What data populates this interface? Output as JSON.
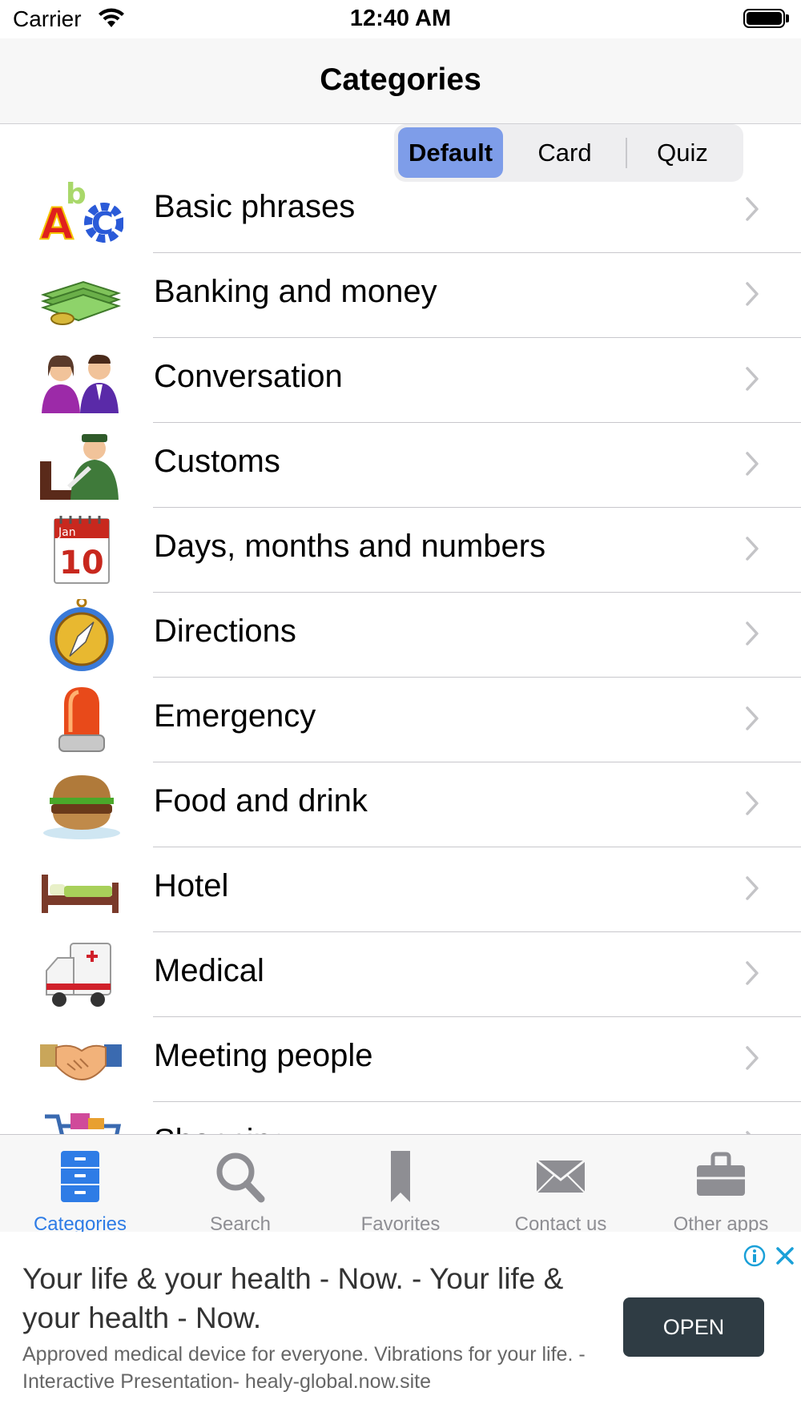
{
  "status_bar": {
    "carrier": "Carrier",
    "time": "12:40 AM"
  },
  "nav": {
    "title": "Categories"
  },
  "segments": [
    {
      "label": "Default",
      "selected": true
    },
    {
      "label": "Card",
      "selected": false
    },
    {
      "label": "Quiz",
      "selected": false
    }
  ],
  "list": {
    "items": [
      {
        "label": "Basic phrases",
        "icon": "abc-letters-icon"
      },
      {
        "label": "Banking and money",
        "icon": "money-stack-icon"
      },
      {
        "label": "Conversation",
        "icon": "people-talking-icon"
      },
      {
        "label": "Customs",
        "icon": "customs-officer-icon"
      },
      {
        "label": "Days, months and numbers",
        "icon": "calendar-icon"
      },
      {
        "label": "Directions",
        "icon": "compass-icon"
      },
      {
        "label": "Emergency",
        "icon": "siren-icon"
      },
      {
        "label": "Food and drink",
        "icon": "burger-icon"
      },
      {
        "label": "Hotel",
        "icon": "bed-icon"
      },
      {
        "label": "Medical",
        "icon": "ambulance-icon"
      },
      {
        "label": "Meeting people",
        "icon": "handshake-icon"
      },
      {
        "label": "Shopping",
        "icon": "shopping-cart-icon"
      }
    ],
    "calendar_icon_text": {
      "month": "Jan",
      "day": "10"
    }
  },
  "tabs": [
    {
      "label": "Categories",
      "icon": "file-cabinet-icon",
      "active": true
    },
    {
      "label": "Search",
      "icon": "magnifier-icon",
      "active": false
    },
    {
      "label": "Favorites",
      "icon": "bookmark-icon",
      "active": false
    },
    {
      "label": "Contact us",
      "icon": "envelope-icon",
      "active": false
    },
    {
      "label": "Other apps",
      "icon": "briefcase-icon",
      "active": false
    }
  ],
  "ad": {
    "title": "Your life & your health - Now. - Your life & your health - Now.",
    "body": "Approved medical device for everyone. Vibrations for your life. -Interactive Presentation- healy-global.now.site",
    "cta": "OPEN"
  },
  "colors": {
    "tint": "#2e7ce6",
    "segment_selected": "#7e9de9",
    "tab_inactive": "#8e8e93",
    "ad_button": "#2f3c44"
  }
}
